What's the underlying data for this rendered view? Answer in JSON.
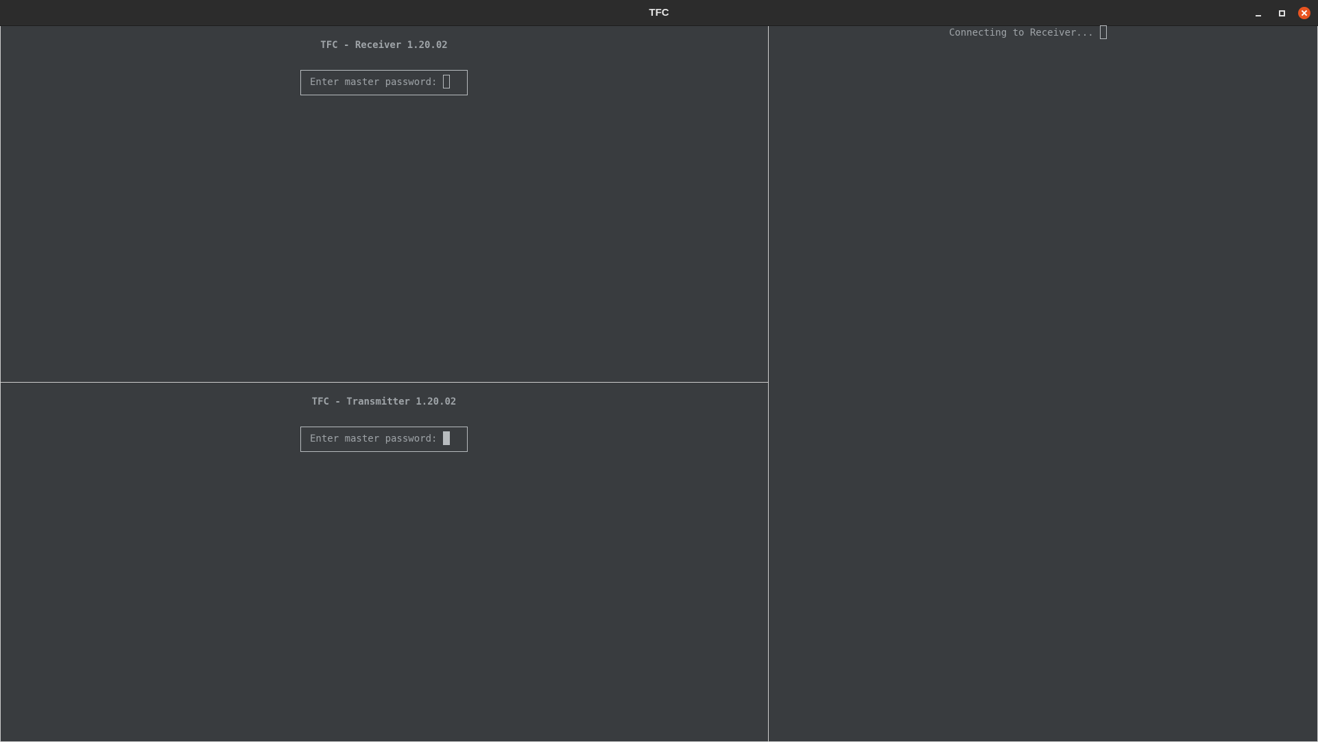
{
  "window": {
    "title": "TFC"
  },
  "receiver": {
    "heading": "TFC - Receiver 1.20.02",
    "prompt": "Enter master password:"
  },
  "transmitter": {
    "heading": "TFC - Transmitter 1.20.02",
    "prompt": "Enter master password:"
  },
  "relay": {
    "status": "Connecting to Receiver..."
  },
  "colors": {
    "background": "#393c3f",
    "text": "#9fa4a8",
    "close_button": "#e95420"
  },
  "icons": [
    "minimize-icon",
    "maximize-icon",
    "close-icon"
  ]
}
